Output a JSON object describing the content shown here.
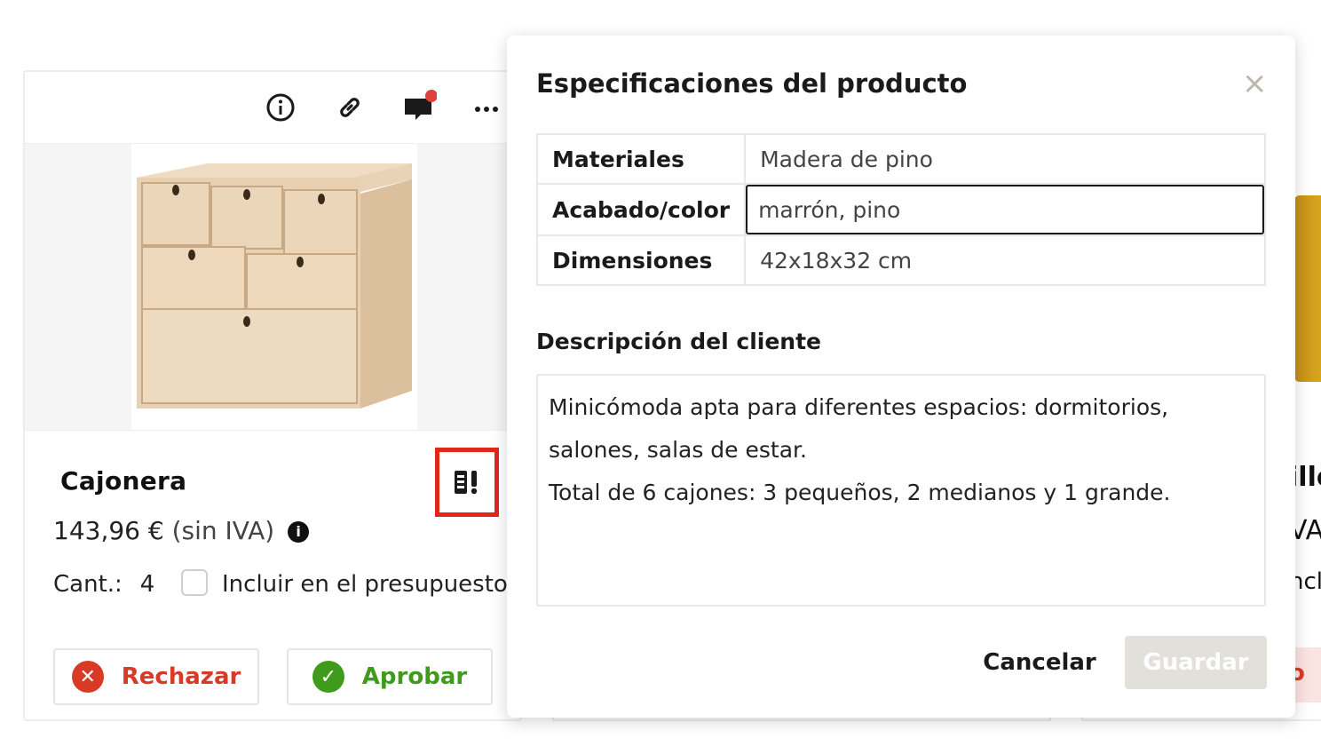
{
  "card": {
    "title": "Cajonera",
    "price": "143,96 €",
    "price_suffix": "(sin IVA)",
    "price_info_glyph": "i",
    "qty_label": "Cant.:",
    "qty_value": "4",
    "include_label": "Incluir en el presupuesto",
    "include_checked": false,
    "reject_label": "Rechazar",
    "approve_label": "Aprobar",
    "reject_color": "#d93a26",
    "approve_color": "#3e9b1c",
    "toolbar_icons": [
      "info-icon",
      "link-icon",
      "comment-icon",
      "more-icon"
    ],
    "has_unread_comment": true,
    "highlight_color": "#e42618"
  },
  "background_peeks": {
    "right_title_fragment": "illo",
    "right_price_fragment": "VA",
    "right_include_fragment": "nclu",
    "right_button_fragment": "o"
  },
  "modal": {
    "title": "Especificaciones del producto",
    "close_glyph": "×",
    "specs": [
      {
        "key": "Materiales",
        "value": "Madera de pino"
      },
      {
        "key": "Acabado/color",
        "value": "marrón, pino"
      },
      {
        "key": "Dimensiones",
        "value": "42x18x32 cm"
      }
    ],
    "description_label": "Descripción del cliente",
    "description_lines": [
      "Minicómoda apta para diferentes espacios: dormitorios,",
      "salones, salas de estar.",
      "Total de 6 cajones: 3 pequeños, 2 medianos y 1 grande."
    ],
    "cancel_label": "Cancelar",
    "save_label": "Guardar",
    "save_enabled": false
  }
}
